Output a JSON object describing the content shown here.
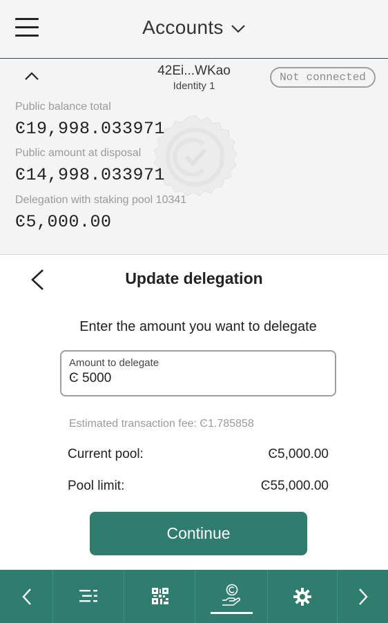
{
  "header": {
    "title": "Accounts"
  },
  "account": {
    "address": "42Ei...WKao",
    "identity": "Identity 1",
    "status": "Not connected",
    "public_balance_label": "Public balance total",
    "public_balance": "Ͼ19,998.033971",
    "at_disposal_label": "Public amount at disposal",
    "at_disposal": "Ͼ14,998.033971",
    "delegation_label": "Delegation with staking pool 10341",
    "delegation": "Ͼ5,000.00"
  },
  "delegation_form": {
    "title": "Update delegation",
    "instruction": "Enter the amount you want to delegate",
    "amount_label": "Amount to delegate",
    "amount_value": "Ͼ 5000",
    "fee_text": "Estimated transaction fee: Ͼ1.785858",
    "current_pool_label": "Current pool:",
    "current_pool_value": "Ͼ5,000.00",
    "pool_limit_label": "Pool limit:",
    "pool_limit_value": "Ͼ55,000.00",
    "continue_label": "Continue"
  },
  "bottom_nav": {
    "items": [
      "previous-icon",
      "list-icon",
      "qr-code-icon",
      "delegation-icon",
      "settings-icon",
      "next-icon"
    ],
    "active": "delegation-icon"
  },
  "colors": {
    "accent": "#2e7d6e",
    "header_bg": "#f5f5f5",
    "card_bg": "#f4f4f4"
  }
}
